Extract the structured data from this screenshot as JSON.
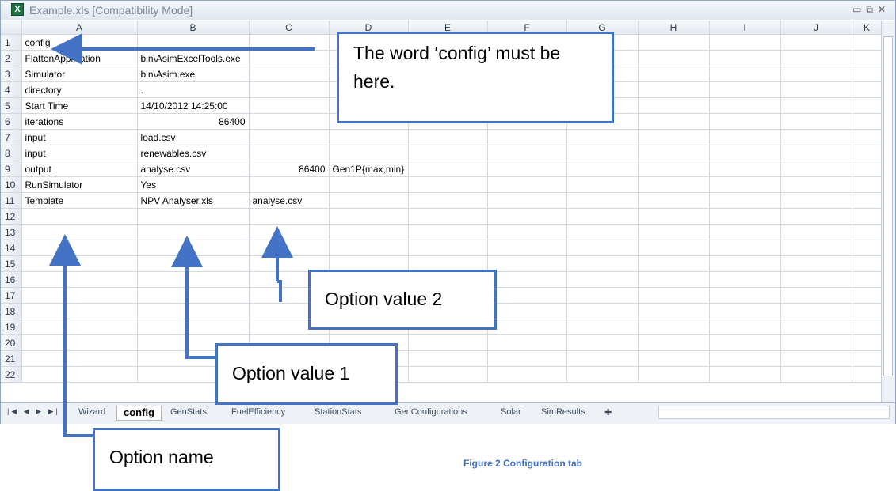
{
  "window": {
    "title": "Example.xls  [Compatibility Mode]",
    "icon": "excel-icon"
  },
  "columns": [
    "A",
    "B",
    "C",
    "D",
    "E",
    "F",
    "G",
    "H",
    "I",
    "J",
    "K"
  ],
  "rows": [
    {
      "n": "1",
      "a": "config",
      "b": "",
      "c": "",
      "d": ""
    },
    {
      "n": "2",
      "a": "FlattenApplication",
      "b": "bin\\AsimExcelTools.exe",
      "c": "",
      "d": ""
    },
    {
      "n": "3",
      "a": "Simulator",
      "b": "bin\\Asim.exe",
      "c": "",
      "d": ""
    },
    {
      "n": "4",
      "a": "directory",
      "b": ".",
      "c": "",
      "d": ""
    },
    {
      "n": "5",
      "a": "Start Time",
      "b": "14/10/2012 14:25:00",
      "c": "",
      "d": ""
    },
    {
      "n": "6",
      "a": "iterations",
      "b": "86400",
      "c": "",
      "d": ""
    },
    {
      "n": "7",
      "a": "input",
      "b": "load.csv",
      "c": "",
      "d": ""
    },
    {
      "n": "8",
      "a": "input",
      "b": "renewables.csv",
      "c": "",
      "d": ""
    },
    {
      "n": "9",
      "a": "output",
      "b": "analyse.csv",
      "c": "86400",
      "d": "Gen1P{max,min}"
    },
    {
      "n": "10",
      "a": "RunSimulator",
      "b": "Yes",
      "c": "",
      "d": ""
    },
    {
      "n": "11",
      "a": "Template",
      "b": "NPV Analyser.xls",
      "c": "analyse.csv",
      "d": ""
    },
    {
      "n": "12",
      "a": "",
      "b": "",
      "c": "",
      "d": ""
    },
    {
      "n": "13",
      "a": "",
      "b": "",
      "c": "",
      "d": ""
    },
    {
      "n": "14",
      "a": "",
      "b": "",
      "c": "",
      "d": ""
    },
    {
      "n": "15",
      "a": "",
      "b": "",
      "c": "",
      "d": ""
    },
    {
      "n": "16",
      "a": "",
      "b": "",
      "c": "",
      "d": ""
    },
    {
      "n": "17",
      "a": "",
      "b": "",
      "c": "",
      "d": ""
    },
    {
      "n": "18",
      "a": "",
      "b": "",
      "c": "",
      "d": ""
    },
    {
      "n": "19",
      "a": "",
      "b": "",
      "c": "",
      "d": ""
    },
    {
      "n": "20",
      "a": "",
      "b": "",
      "c": "",
      "d": ""
    },
    {
      "n": "21",
      "a": "",
      "b": "",
      "c": "",
      "d": ""
    },
    {
      "n": "22",
      "a": "",
      "b": "",
      "c": "",
      "d": ""
    }
  ],
  "tabs": [
    "Wizard",
    "config",
    "GenStats",
    "FuelEfficiency",
    "StationStats",
    "GenConfigurations",
    "Solar",
    "SimResults"
  ],
  "active_tab": "config",
  "callouts": {
    "config_here": "The word ‘config’ must be here.",
    "option_value_2": "Option value 2",
    "option_value_1": "Option value 1",
    "option_name": "Option name"
  },
  "caption": "Figure 2 Configuration tab",
  "colors": {
    "accent": "#4472c4",
    "excel_green": "#1e7145"
  }
}
